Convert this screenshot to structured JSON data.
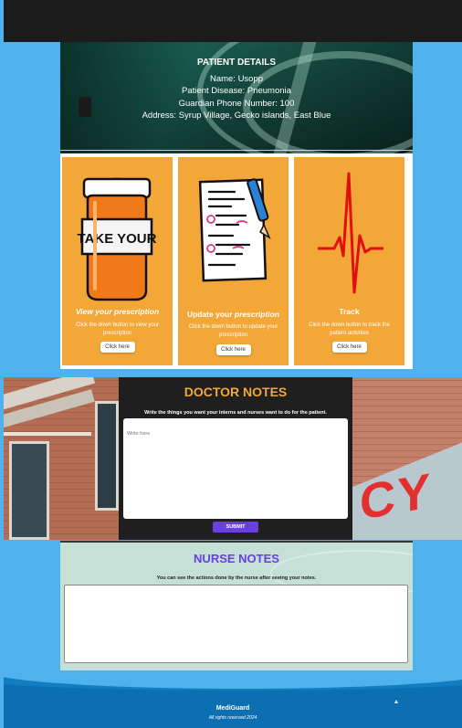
{
  "patient_details": {
    "heading": "PATIENT DETAILS",
    "name_line": "Name: Usopp",
    "disease_line": "Patient Disease: Pneumonia",
    "guardian_line": "Guardian Phone Number: 100",
    "address_line": "Address: Syrup Village, Gecko islands, East Blue"
  },
  "cards": [
    {
      "icon": "pill-bottle-icon",
      "image_text": "TAKE YOUR",
      "title_pre": "",
      "title_em": "View your prescription",
      "description": "Click the down button to view your prescription",
      "button_label": "Click here"
    },
    {
      "icon": "clipboard-pen-icon",
      "title_pre": "Update your ",
      "title_em": "prescription",
      "description": "Click the down button to update your prescription",
      "button_label": "Click here"
    },
    {
      "icon": "heartbeat-icon",
      "title_pre": "Track",
      "title_em": "",
      "description": "Click the down button to track the patient activities",
      "button_label": "Click here"
    }
  ],
  "doctor_notes": {
    "title": "DOCTOR NOTES",
    "subtitle": "Write the things you want your interns and nurses want to do for the patient.",
    "placeholder": "Write here",
    "submit_label": "SUBMIT"
  },
  "nurse_notes": {
    "title": "NURSE NOTES",
    "subtitle": "You can see the actions done by the nurse after seeing your notes."
  },
  "footer": {
    "brand": "MediGuard",
    "rights": "All rights reserved 2024"
  },
  "colors": {
    "page_bg": "#4fb2ec",
    "card_orange": "#f3a738",
    "doctor_title": "#f3a738",
    "nurse_title": "#6a3fe0",
    "submit_bg": "#6a3fe0",
    "footer_bg": "#0b6fb2"
  }
}
